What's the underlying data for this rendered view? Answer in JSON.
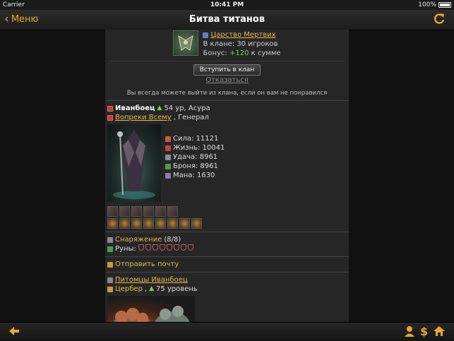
{
  "status_bar": {
    "carrier": "Carrier",
    "time": "10:41 PM",
    "battery": "100%"
  },
  "nav": {
    "back_label": "Меню",
    "title": "Битва титанов"
  },
  "clan": {
    "name": "Царство Мертвих",
    "members": "В клане: 30 игроков",
    "bonus_prefix": "Бонус:",
    "bonus_value": "+120",
    "bonus_suffix": "к сумме",
    "join_button": "Вступить в клан",
    "refuse_link": "Отказаться",
    "note": "Вы всегда можете выйти из клана, если он вам не понравился"
  },
  "hero": {
    "name": "Иванбоец",
    "level_info": "54 ур, Асура",
    "guild": "Вопреки Всему",
    "rank": ", Генерал",
    "stats": [
      {
        "label": "Сила: 11121",
        "color": "#c85c3c"
      },
      {
        "label": "Жизнь: 10041",
        "color": "#c84040"
      },
      {
        "label": "Удача: 8961",
        "color": "#8a8aa0"
      },
      {
        "label": "Броня: 8961",
        "color": "#4aa04a"
      },
      {
        "label": "Мана: 1630",
        "color": "#8a7ab0"
      }
    ]
  },
  "equipment": {
    "label": "Снаряжение",
    "count": "(8/8)",
    "runes_label": "Руны:"
  },
  "mail": {
    "label": "Отправить почту"
  },
  "pets": {
    "title": "Питомцы Иванбоец",
    "pet_name": "Цербер",
    "pet_level": "75 уровень"
  },
  "colors": {
    "accent": "#e6b84c",
    "green": "#7dcf5a"
  }
}
